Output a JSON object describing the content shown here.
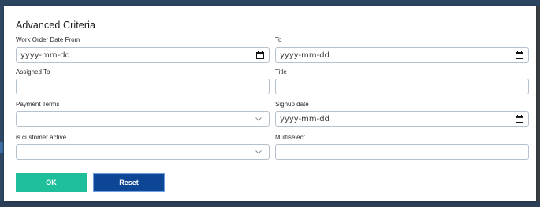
{
  "dialog": {
    "title": "Advanced Criteria"
  },
  "fields": {
    "work_order_date_from": {
      "label": "Work Order Date From",
      "placeholder": "yyyy-mm-dd",
      "icon": "calendar-icon"
    },
    "to": {
      "label": "To",
      "placeholder": "yyyy-mm-dd",
      "icon": "calendar-icon"
    },
    "assigned_to": {
      "label": "Assigned To",
      "value": ""
    },
    "title": {
      "label": "Title",
      "value": ""
    },
    "payment_terms": {
      "label": "Payment Terms",
      "selected": "",
      "icon": "chevron-down-icon"
    },
    "signup_date": {
      "label": "Signup date",
      "placeholder": "yyyy-mm-dd",
      "icon": "calendar-icon"
    },
    "is_customer_active": {
      "label": "is customer active",
      "selected": "",
      "icon": "chevron-down-icon"
    },
    "multiselect": {
      "label": "Multiselect",
      "value": ""
    }
  },
  "buttons": {
    "ok": {
      "label": "OK",
      "color": "#1fbf9c"
    },
    "reset": {
      "label": "Reset",
      "color": "#0d4695"
    }
  },
  "colors": {
    "border": "#b7c1cc",
    "background_dark": "#233b54"
  }
}
